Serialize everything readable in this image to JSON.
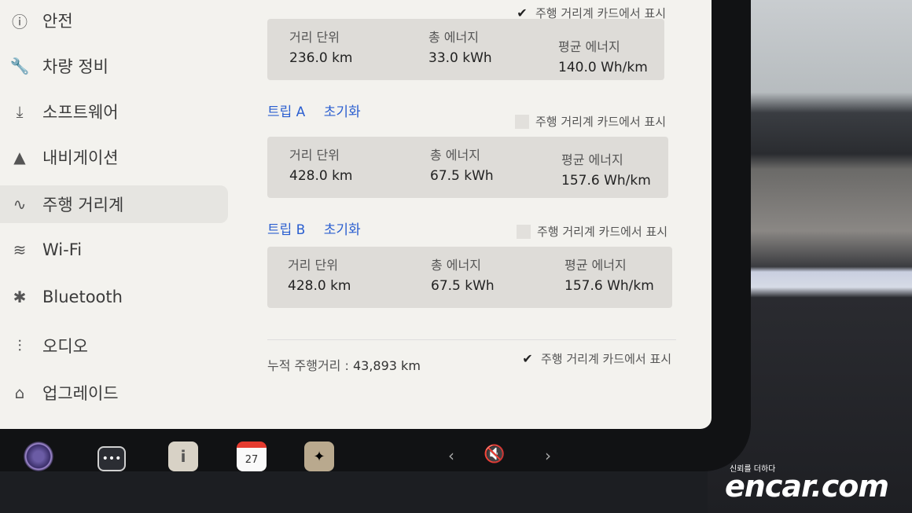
{
  "sidebar": {
    "items": [
      {
        "icon": "alert-circle-icon",
        "glyph": "ⓘ",
        "label": "안전"
      },
      {
        "icon": "wrench-icon",
        "glyph": "🔧",
        "label": "차량 정비"
      },
      {
        "icon": "download-icon",
        "glyph": "⤓",
        "label": "소프트웨어"
      },
      {
        "icon": "navigation-arrow-icon",
        "glyph": "▲",
        "label": "내비게이션"
      },
      {
        "icon": "trip-route-icon",
        "glyph": "∿",
        "label": "주행 거리계"
      },
      {
        "icon": "wifi-icon",
        "glyph": "≋",
        "label": "Wi-Fi"
      },
      {
        "icon": "bluetooth-icon",
        "glyph": "✱",
        "label": "Bluetooth"
      },
      {
        "icon": "equalizer-icon",
        "glyph": "⫶",
        "label": "오디오"
      },
      {
        "icon": "lock-icon",
        "glyph": "⌂",
        "label": "업그레이드"
      }
    ],
    "active_index": 4
  },
  "main": {
    "show_on_card_label": "주행 거리계 카드에서 표시",
    "metric_labels": {
      "distance": "거리 단위",
      "energy": "총 에너지",
      "avg": "평균 에너지"
    },
    "since_last": {
      "show_on_card": true,
      "distance": "236.0 km",
      "energy": "33.0 kWh",
      "avg": "140.0 Wh/km"
    },
    "trip_a": {
      "title": "트립 A",
      "reset": "초기화",
      "show_on_card": false,
      "distance": "428.0 km",
      "energy": "67.5 kWh",
      "avg": "157.6 Wh/km"
    },
    "trip_b": {
      "title": "트립 B",
      "reset": "초기화",
      "show_on_card": false,
      "distance": "428.0 km",
      "energy": "67.5 kWh",
      "avg": "157.6 Wh/km"
    },
    "odometer": {
      "label": "누적 주행거리 :",
      "value": "43,893 km",
      "show_on_card": true
    }
  },
  "taskbar": {
    "calendar_day": "27",
    "dots": "•••",
    "manual": "i",
    "prev": "‹",
    "next": "›",
    "mute": "🔇"
  },
  "watermark": {
    "sub": "신뢰를 더하다",
    "brand": "encar.com"
  }
}
